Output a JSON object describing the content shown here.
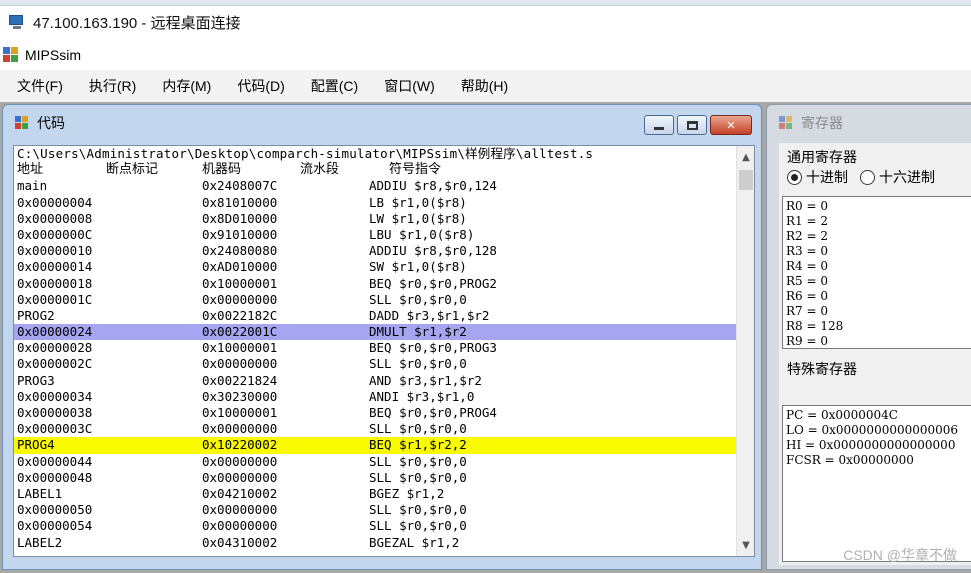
{
  "remote_desktop": {
    "title": "47.100.163.190 - 远程桌面连接"
  },
  "app": {
    "title": "MIPSsim"
  },
  "menu": [
    "文件(F)",
    "执行(R)",
    "内存(M)",
    "代码(D)",
    "配置(C)",
    "窗口(W)",
    "帮助(H)"
  ],
  "code_window": {
    "title": "代码",
    "file_path": "C:\\Users\\Administrator\\Desktop\\comparch-simulator\\MIPSsim\\样例程序\\alltest.s",
    "headers": [
      "地址",
      "断点标记",
      "机器码",
      "流水段",
      "符号指令"
    ],
    "rows": [
      {
        "addr": "main",
        "mc": "0x2408007C",
        "instr": "ADDIU $r8,$r0,124",
        "state": ""
      },
      {
        "addr": "0x00000004",
        "mc": "0x81010000",
        "instr": "LB $r1,0($r8)",
        "state": ""
      },
      {
        "addr": "0x00000008",
        "mc": "0x8D010000",
        "instr": "LW $r1,0($r8)",
        "state": ""
      },
      {
        "addr": "0x0000000C",
        "mc": "0x91010000",
        "instr": "LBU $r1,0($r8)",
        "state": ""
      },
      {
        "addr": "0x00000010",
        "mc": "0x24080080",
        "instr": "ADDIU $r8,$r0,128",
        "state": ""
      },
      {
        "addr": "0x00000014",
        "mc": "0xAD010000",
        "instr": "SW $r1,0($r8)",
        "state": ""
      },
      {
        "addr": "0x00000018",
        "mc": "0x10000001",
        "instr": "BEQ $r0,$r0,PROG2",
        "state": ""
      },
      {
        "addr": "0x0000001C",
        "mc": "0x00000000",
        "instr": "SLL $r0,$r0,0",
        "state": ""
      },
      {
        "addr": "PROG2",
        "mc": "0x0022182C",
        "instr": "DADD $r3,$r1,$r2",
        "state": ""
      },
      {
        "addr": "0x00000024",
        "mc": "0x0022001C",
        "instr": "DMULT $r1,$r2",
        "state": "selected"
      },
      {
        "addr": "0x00000028",
        "mc": "0x10000001",
        "instr": "BEQ $r0,$r0,PROG3",
        "state": ""
      },
      {
        "addr": "0x0000002C",
        "mc": "0x00000000",
        "instr": "SLL $r0,$r0,0",
        "state": ""
      },
      {
        "addr": "PROG3",
        "mc": "0x00221824",
        "instr": "AND $r3,$r1,$r2",
        "state": ""
      },
      {
        "addr": "0x00000034",
        "mc": "0x30230000",
        "instr": "ANDI $r3,$r1,0",
        "state": ""
      },
      {
        "addr": "0x00000038",
        "mc": "0x10000001",
        "instr": "BEQ $r0,$r0,PROG4",
        "state": ""
      },
      {
        "addr": "0x0000003C",
        "mc": "0x00000000",
        "instr": "SLL $r0,$r0,0",
        "state": ""
      },
      {
        "addr": "PROG4",
        "mc": "0x10220002",
        "instr": "BEQ $r1,$r2,2",
        "state": "breakpoint"
      },
      {
        "addr": "0x00000044",
        "mc": "0x00000000",
        "instr": "SLL $r0,$r0,0",
        "state": ""
      },
      {
        "addr": "0x00000048",
        "mc": "0x00000000",
        "instr": "SLL $r0,$r0,0",
        "state": ""
      },
      {
        "addr": "LABEL1",
        "mc": "0x04210002",
        "instr": "BGEZ $r1,2",
        "state": ""
      },
      {
        "addr": "0x00000050",
        "mc": "0x00000000",
        "instr": "SLL $r0,$r0,0",
        "state": ""
      },
      {
        "addr": "0x00000054",
        "mc": "0x00000000",
        "instr": "SLL $r0,$r0,0",
        "state": ""
      },
      {
        "addr": "LABEL2",
        "mc": "0x04310002",
        "instr": "BGEZAL $r1,2",
        "state": ""
      }
    ],
    "colors": {
      "selected": "#a5a5f1",
      "breakpoint": "#fbfb00"
    }
  },
  "register_window": {
    "title": "寄存器",
    "general_label": "通用寄存器",
    "radio_decimal": "十进制",
    "radio_hex": "十六进制",
    "radio_selected": "decimal",
    "general": [
      "R0 = 0",
      "R1 = 2",
      "R2 = 2",
      "R3 = 0",
      "R4 = 0",
      "R5 = 0",
      "R6 = 0",
      "R7 = 0",
      "R8 = 128",
      "R9 = 0"
    ],
    "special_label": "特殊寄存器",
    "special": [
      "PC = 0x0000004C",
      "LO = 0x0000000000000006",
      "HI = 0x0000000000000000",
      "FCSR = 0x00000000"
    ]
  },
  "watermark": "CSDN @华章不做"
}
